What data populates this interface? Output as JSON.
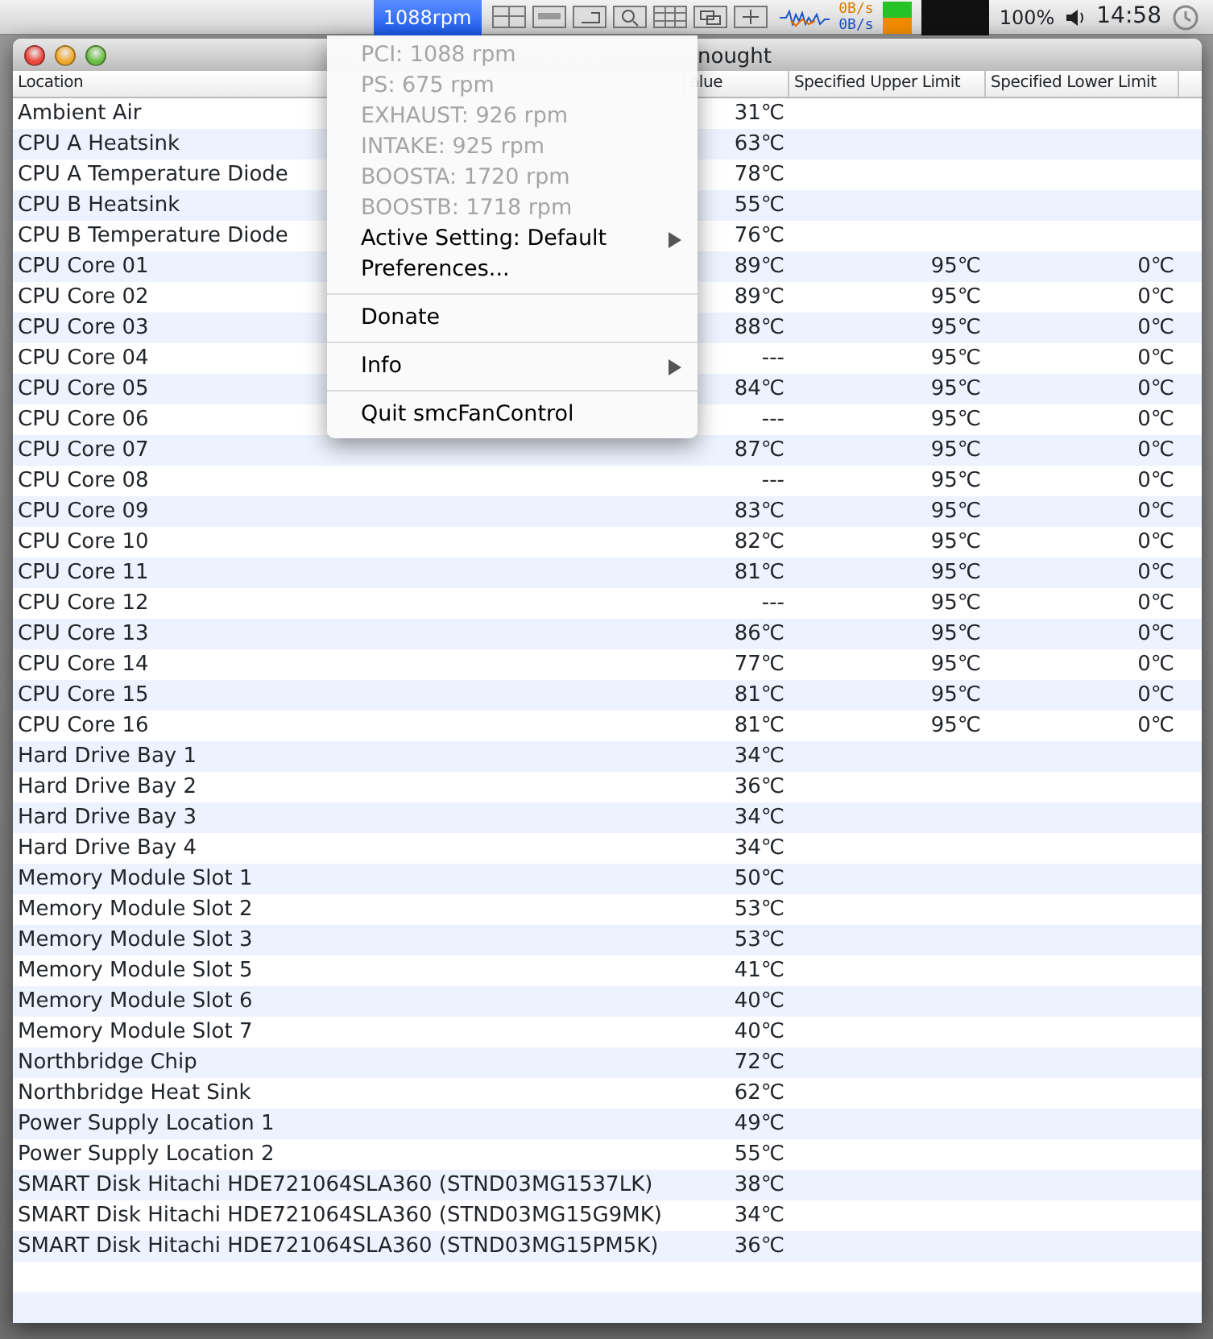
{
  "menu_bar": {
    "fan_speed": {
      "label": "1088rpm",
      "selected": true
    },
    "network": {
      "upload": "0B/s",
      "download": "0B/s"
    },
    "battery": "100%",
    "clock": "14:58"
  },
  "window": {
    "title": "nought"
  },
  "table": {
    "columns": [
      "Location",
      "alue",
      "Specified Upper Limit",
      "Specified Lower Limit"
    ],
    "rows": [
      {
        "location": "Ambient Air",
        "value": "31℃"
      },
      {
        "location": "CPU A Heatsink",
        "value": "63℃"
      },
      {
        "location": "CPU A Temperature Diode",
        "value": "78℃"
      },
      {
        "location": "CPU B Heatsink",
        "value": "55℃"
      },
      {
        "location": "CPU B Temperature Diode",
        "value": "76℃"
      },
      {
        "location": "CPU Core 01",
        "value": "89℃",
        "upper": "95℃",
        "lower": "0℃"
      },
      {
        "location": "CPU Core 02",
        "value": "89℃",
        "upper": "95℃",
        "lower": "0℃"
      },
      {
        "location": "CPU Core 03",
        "value": "88℃",
        "upper": "95℃",
        "lower": "0℃"
      },
      {
        "location": "CPU Core 04",
        "value": "---",
        "upper": "95℃",
        "lower": "0℃"
      },
      {
        "location": "CPU Core 05",
        "value": "84℃",
        "upper": "95℃",
        "lower": "0℃"
      },
      {
        "location": "CPU Core 06",
        "value": "---",
        "upper": "95℃",
        "lower": "0℃"
      },
      {
        "location": "CPU Core 07",
        "value": "87℃",
        "upper": "95℃",
        "lower": "0℃"
      },
      {
        "location": "CPU Core 08",
        "value": "---",
        "upper": "95℃",
        "lower": "0℃"
      },
      {
        "location": "CPU Core 09",
        "value": "83℃",
        "upper": "95℃",
        "lower": "0℃"
      },
      {
        "location": "CPU Core 10",
        "value": "82℃",
        "upper": "95℃",
        "lower": "0℃"
      },
      {
        "location": "CPU Core 11",
        "value": "81℃",
        "upper": "95℃",
        "lower": "0℃"
      },
      {
        "location": "CPU Core 12",
        "value": "---",
        "upper": "95℃",
        "lower": "0℃"
      },
      {
        "location": "CPU Core 13",
        "value": "86℃",
        "upper": "95℃",
        "lower": "0℃"
      },
      {
        "location": "CPU Core 14",
        "value": "77℃",
        "upper": "95℃",
        "lower": "0℃"
      },
      {
        "location": "CPU Core 15",
        "value": "81℃",
        "upper": "95℃",
        "lower": "0℃"
      },
      {
        "location": "CPU Core 16",
        "value": "81℃",
        "upper": "95℃",
        "lower": "0℃"
      },
      {
        "location": "Hard Drive Bay 1",
        "value": "34℃"
      },
      {
        "location": "Hard Drive Bay 2",
        "value": "36℃"
      },
      {
        "location": "Hard Drive Bay 3",
        "value": "34℃"
      },
      {
        "location": "Hard Drive Bay 4",
        "value": "34℃"
      },
      {
        "location": "Memory Module Slot 1",
        "value": "50℃"
      },
      {
        "location": "Memory Module Slot 2",
        "value": "53℃"
      },
      {
        "location": "Memory Module Slot 3",
        "value": "53℃"
      },
      {
        "location": "Memory Module Slot 5",
        "value": "41℃"
      },
      {
        "location": "Memory Module Slot 6",
        "value": "40℃"
      },
      {
        "location": "Memory Module Slot 7",
        "value": "40℃"
      },
      {
        "location": "Northbridge Chip",
        "value": "72℃"
      },
      {
        "location": "Northbridge Heat Sink",
        "value": "62℃"
      },
      {
        "location": "Power Supply Location 1",
        "value": "49℃"
      },
      {
        "location": "Power Supply Location 2",
        "value": "55℃"
      },
      {
        "location": "SMART Disk Hitachi HDE721064SLA360 (STND03MG1537LK)",
        "value": "38℃"
      },
      {
        "location": "SMART Disk Hitachi HDE721064SLA360 (STND03MG15G9MK)",
        "value": "34℃"
      },
      {
        "location": "SMART Disk Hitachi HDE721064SLA360 (STND03MG15PM5K)",
        "value": "36℃"
      }
    ]
  },
  "menu": {
    "groups": [
      [
        {
          "label": "PCI: 1088 rpm",
          "disabled": true,
          "submenu": false
        },
        {
          "label": "PS: 675 rpm",
          "disabled": true,
          "submenu": false
        },
        {
          "label": "EXHAUST: 926 rpm",
          "disabled": true,
          "submenu": false
        },
        {
          "label": "INTAKE: 925 rpm",
          "disabled": true,
          "submenu": false
        },
        {
          "label": "BOOSTA: 1720 rpm",
          "disabled": true,
          "submenu": false
        },
        {
          "label": "BOOSTB: 1718 rpm",
          "disabled": true,
          "submenu": false
        },
        {
          "label": "Active Setting: Default",
          "disabled": false,
          "submenu": true
        },
        {
          "label": "Preferences...",
          "disabled": false,
          "submenu": false
        }
      ],
      [
        {
          "label": "Donate",
          "disabled": false,
          "submenu": false
        }
      ],
      [
        {
          "label": "Info",
          "disabled": false,
          "submenu": true
        }
      ],
      [
        {
          "label": "Quit smcFanControl",
          "disabled": false,
          "submenu": false
        }
      ]
    ]
  }
}
